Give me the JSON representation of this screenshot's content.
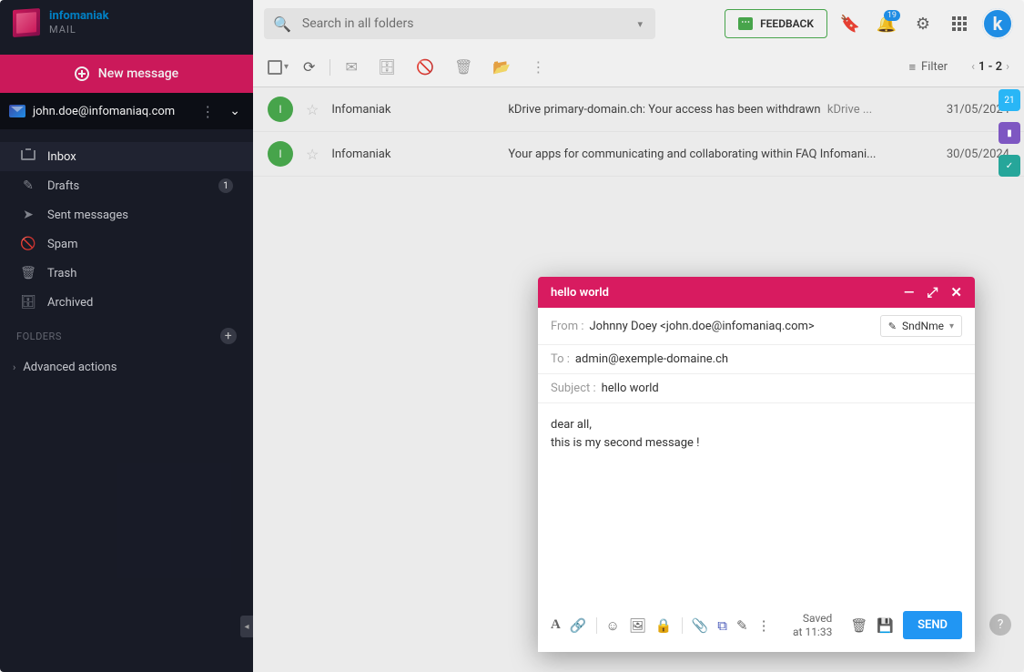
{
  "brand": {
    "name": "infomaniak",
    "product": "MAIL"
  },
  "newMessageLabel": "New message",
  "accountEmail": "john.doe@infomaniaq.com",
  "folders": [
    {
      "label": "Inbox",
      "icon": "inbox",
      "active": true
    },
    {
      "label": "Drafts",
      "icon": "drafts",
      "badge": "1"
    },
    {
      "label": "Sent messages",
      "icon": "sent"
    },
    {
      "label": "Spam",
      "icon": "spam"
    },
    {
      "label": "Trash",
      "icon": "trash"
    },
    {
      "label": "Archived",
      "icon": "archive"
    }
  ],
  "foldersHeader": "FOLDERS",
  "advancedActions": "Advanced actions",
  "search": {
    "placeholder": "Search in all folders"
  },
  "feedbackLabel": "FEEDBACK",
  "notifCount": "19",
  "filterLabel": "Filter",
  "pageRange": "1 - 2",
  "mails": [
    {
      "initial": "I",
      "sender": "Infomaniak",
      "subject": "kDrive primary-domain.ch: Your access has been withdrawn",
      "preview": "kDrive ...",
      "date": "31/05/2024"
    },
    {
      "initial": "I",
      "sender": "Infomaniak",
      "subject": "Your apps for communicating and collaborating within FAQ Infomani...",
      "preview": "",
      "date": "30/05/2024"
    }
  ],
  "rail": {
    "cal": "21"
  },
  "compose": {
    "title": "hello world",
    "fromLabel": "From :",
    "from": "Johnny Doey <john.doe@infomaniaq.com>",
    "senderName": "SndNme",
    "toLabel": "To :",
    "to": "admin@exemple-domaine.ch",
    "subjectLabel": "Subject :",
    "subject": "hello world",
    "body": "dear all,\nthis is my second message !",
    "savedLabel": "Saved",
    "savedTime": "at 11:33",
    "sendLabel": "SEND"
  }
}
